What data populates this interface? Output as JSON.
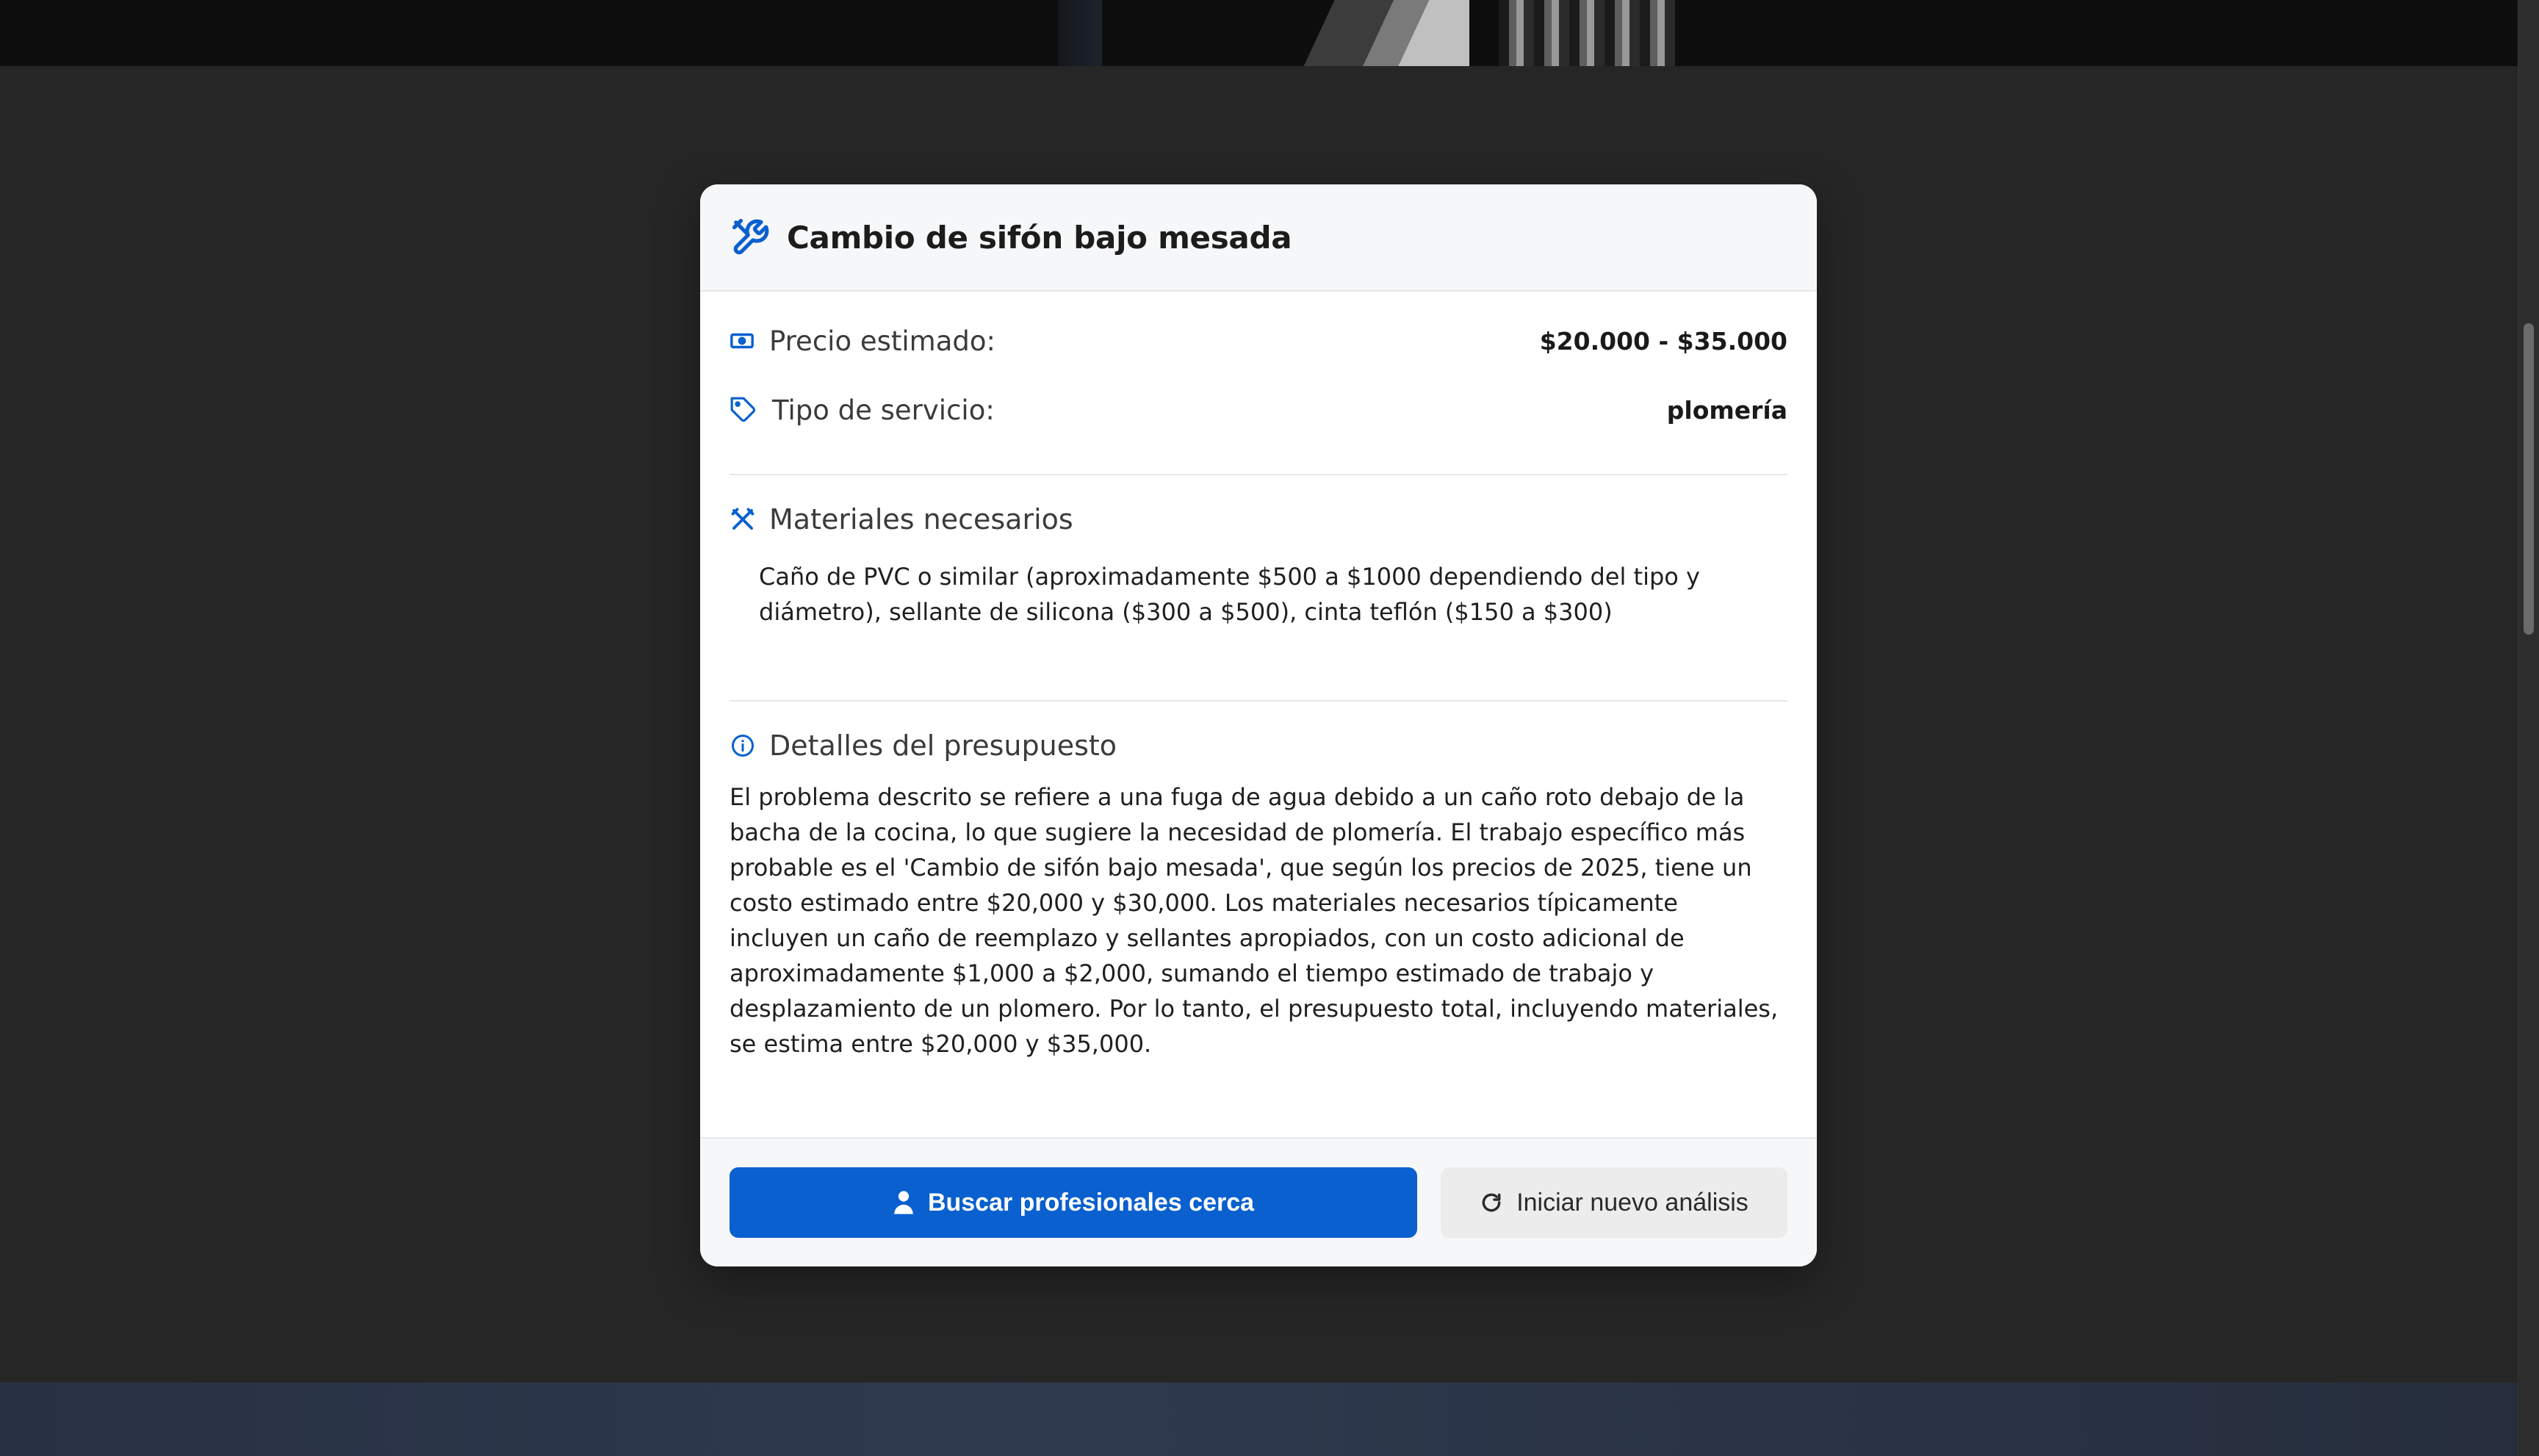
{
  "modal": {
    "title": "Cambio de sifón bajo mesada",
    "title_icon": "tools-icon",
    "price": {
      "label": "Precio estimado:",
      "value": "$20.000 - $35.000",
      "icon": "money-icon"
    },
    "service_type": {
      "label": "Tipo de servicio:",
      "value": "plomería",
      "icon": "tag-icon"
    },
    "materials": {
      "title": "Materiales necesarios",
      "icon": "wrench-cross-icon",
      "text": "Caño de PVC o similar (aproximadamente $500 a $1000 dependiendo del tipo y diámetro), sellante de silicona ($300 a $500), cinta teflón ($150 a $300)"
    },
    "details": {
      "title": "Detalles del presupuesto",
      "icon": "info-icon",
      "text": "El problema descrito se refiere a una fuga de agua debido a un caño roto debajo de la bacha de la cocina, lo que sugiere la necesidad de plomería. El trabajo específico más probable es el 'Cambio de sifón bajo mesada', que según los precios de 2025, tiene un costo estimado entre $20,000 y $30,000. Los materiales necesarios típicamente incluyen un caño de reemplazo y sellantes apropiados, con un costo adicional de aproximadamente $1,000 a $2,000, sumando el tiempo estimado de trabajo y desplazamiento de un plomero. Por lo tanto, el presupuesto total, incluyendo materiales, se estima entre $20,000 y $35,000."
    },
    "actions": {
      "primary_label": "Buscar profesionales cerca",
      "primary_icon": "user-icon",
      "secondary_label": "Iniciar nuevo análisis",
      "secondary_icon": "refresh-icon"
    }
  },
  "colors": {
    "accent": "#0a60cf",
    "background": "#262626",
    "card": "#ffffff"
  }
}
